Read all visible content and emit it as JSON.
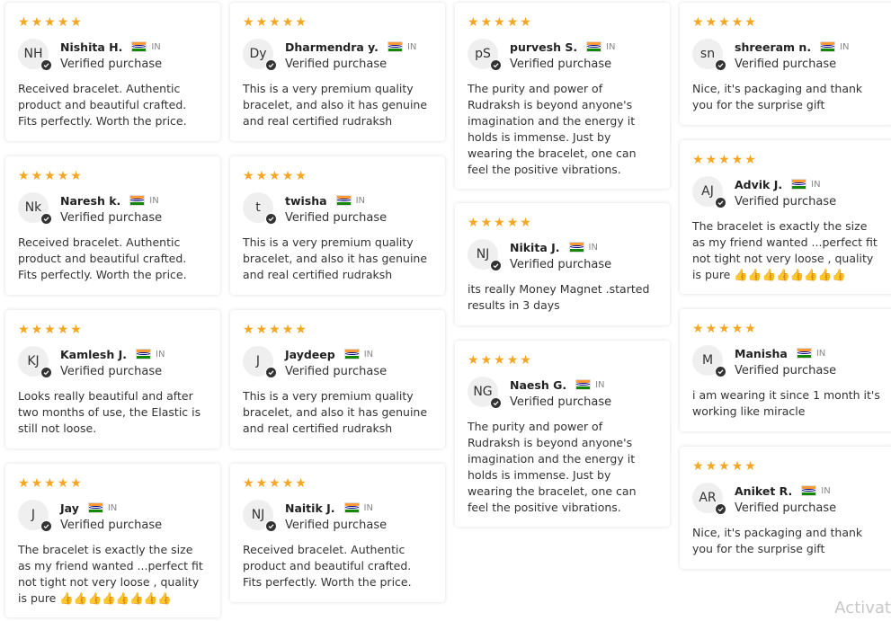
{
  "columns": [
    {
      "cards": [
        {
          "initials": "NH",
          "name": "Nishita H.",
          "country": "IN",
          "verified": "Verified purchase",
          "text": "Received bracelet. Authentic product and beautiful crafted. Fits perfectly. Worth the price."
        },
        {
          "initials": "Nk",
          "name": "Naresh k.",
          "country": "IN",
          "verified": "Verified purchase",
          "text": "Received bracelet. Authentic product and beautiful crafted. Fits perfectly. Worth the price."
        },
        {
          "initials": "KJ",
          "name": "Kamlesh J.",
          "country": "IN",
          "verified": "Verified purchase",
          "text": "Looks really beautiful and after two months of use, the Elastic is still not loose."
        },
        {
          "initials": "J",
          "name": "Jay",
          "country": "IN",
          "verified": "Verified purchase",
          "text": "The bracelet is exactly the size as my friend wanted ...perfect fit not tight not very loose , quality is pure 👍👍👍👍👍👍👍👍"
        }
      ]
    },
    {
      "cards": [
        {
          "initials": "Dy",
          "name": "Dharmendra y.",
          "country": "IN",
          "verified": "Verified purchase",
          "text": "This is a very premium quality bracelet, and also it has genuine and real certified rudraksh"
        },
        {
          "initials": "t",
          "name": "twisha",
          "country": "IN",
          "verified": "Verified purchase",
          "text": "This is a very premium quality bracelet, and also it has genuine and real certified rudraksh"
        },
        {
          "initials": "J",
          "name": "Jaydeep",
          "country": "IN",
          "verified": "Verified purchase",
          "text": "This is a very premium quality bracelet, and also it has genuine and real certified rudraksh"
        },
        {
          "initials": "NJ",
          "name": "Naitik J.",
          "country": "IN",
          "verified": "Verified purchase",
          "text": "Received bracelet. Authentic product and beautiful crafted. Fits perfectly. Worth the price."
        }
      ]
    },
    {
      "cards": [
        {
          "initials": "pS",
          "name": "purvesh S.",
          "country": "IN",
          "verified": "Verified purchase",
          "text": "The purity and power of Rudraksh is beyond anyone's imagination and the energy it holds is immense. Just by wearing the bracelet, one can feel the positive vibrations."
        },
        {
          "initials": "NJ",
          "name": "Nikita J.",
          "country": "IN",
          "verified": "Verified purchase",
          "text": "its really Money Magnet .started results in 3 days"
        },
        {
          "initials": "NG",
          "name": "Naesh G.",
          "country": "IN",
          "verified": "Verified purchase",
          "text": "The purity and power of Rudraksh is beyond anyone's imagination and the energy it holds is immense. Just by wearing the bracelet, one can feel the positive vibrations."
        }
      ]
    },
    {
      "cards": [
        {
          "initials": "sn",
          "name": "shreeram n.",
          "country": "IN",
          "verified": "Verified purchase",
          "text": "Nice, it's packaging and thank you for the surprise gift"
        },
        {
          "initials": "AJ",
          "name": "Advik J.",
          "country": "IN",
          "verified": "Verified purchase",
          "text": "The bracelet is exactly the size as my friend wanted ...perfect fit not tight not very loose , quality is pure 👍👍👍👍👍👍👍👍"
        },
        {
          "initials": "M",
          "name": "Manisha",
          "country": "IN",
          "verified": "Verified purchase",
          "text": "i am wearing it since 1 month it's working like miracle"
        },
        {
          "initials": "AR",
          "name": "Aniket R.",
          "country": "IN",
          "verified": "Verified purchase",
          "text": "Nice, it's packaging and thank you for the surprise gift"
        }
      ]
    }
  ],
  "rating_stars": 5,
  "colors": {
    "star": "#f5a623",
    "check_badge": "#333333"
  },
  "watermark": "Activat"
}
